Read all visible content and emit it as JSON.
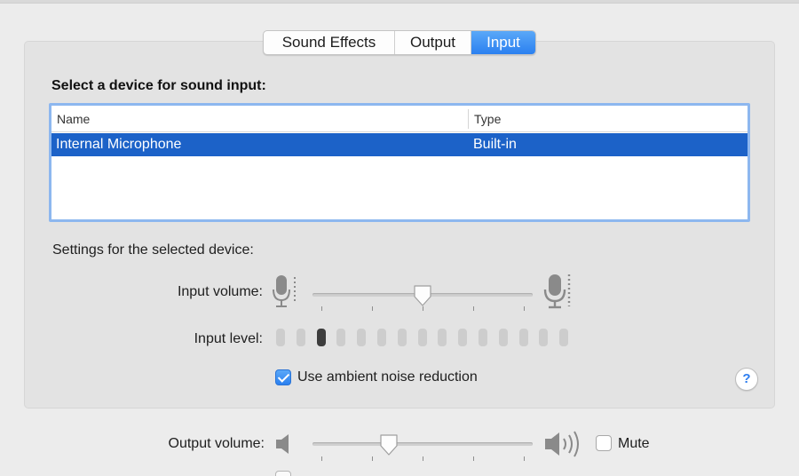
{
  "tabs": [
    {
      "label": "Sound Effects",
      "selected": false
    },
    {
      "label": "Output",
      "selected": false
    },
    {
      "label": "Input",
      "selected": true
    }
  ],
  "input": {
    "heading": "Select a device for sound input:",
    "table": {
      "columns": [
        "Name",
        "Type"
      ],
      "rows": [
        {
          "name": "Internal Microphone",
          "type": "Built-in",
          "selected": true
        }
      ]
    },
    "settings_label": "Settings for the selected device:",
    "input_volume_label": "Input volume:",
    "input_volume_value": 0.5,
    "input_level_label": "Input level:",
    "input_level_segments_total": 15,
    "input_level_segments_active": 3,
    "ambient_noise_label": "Use ambient noise reduction",
    "ambient_noise_checked": true
  },
  "output": {
    "volume_label": "Output volume:",
    "volume_value": 0.33,
    "mute_label": "Mute",
    "mute_checked": false
  },
  "help": {
    "label": "?"
  },
  "colors": {
    "accent": "#2b80f0",
    "selection": "#1c62c8",
    "panel_bg": "#e3e3e3",
    "window_bg": "#ececec"
  },
  "icons": {
    "mic_low": "microphone-low-icon",
    "mic_high": "microphone-high-icon",
    "speaker_low": "speaker-low-icon",
    "speaker_high": "speaker-high-icon"
  }
}
